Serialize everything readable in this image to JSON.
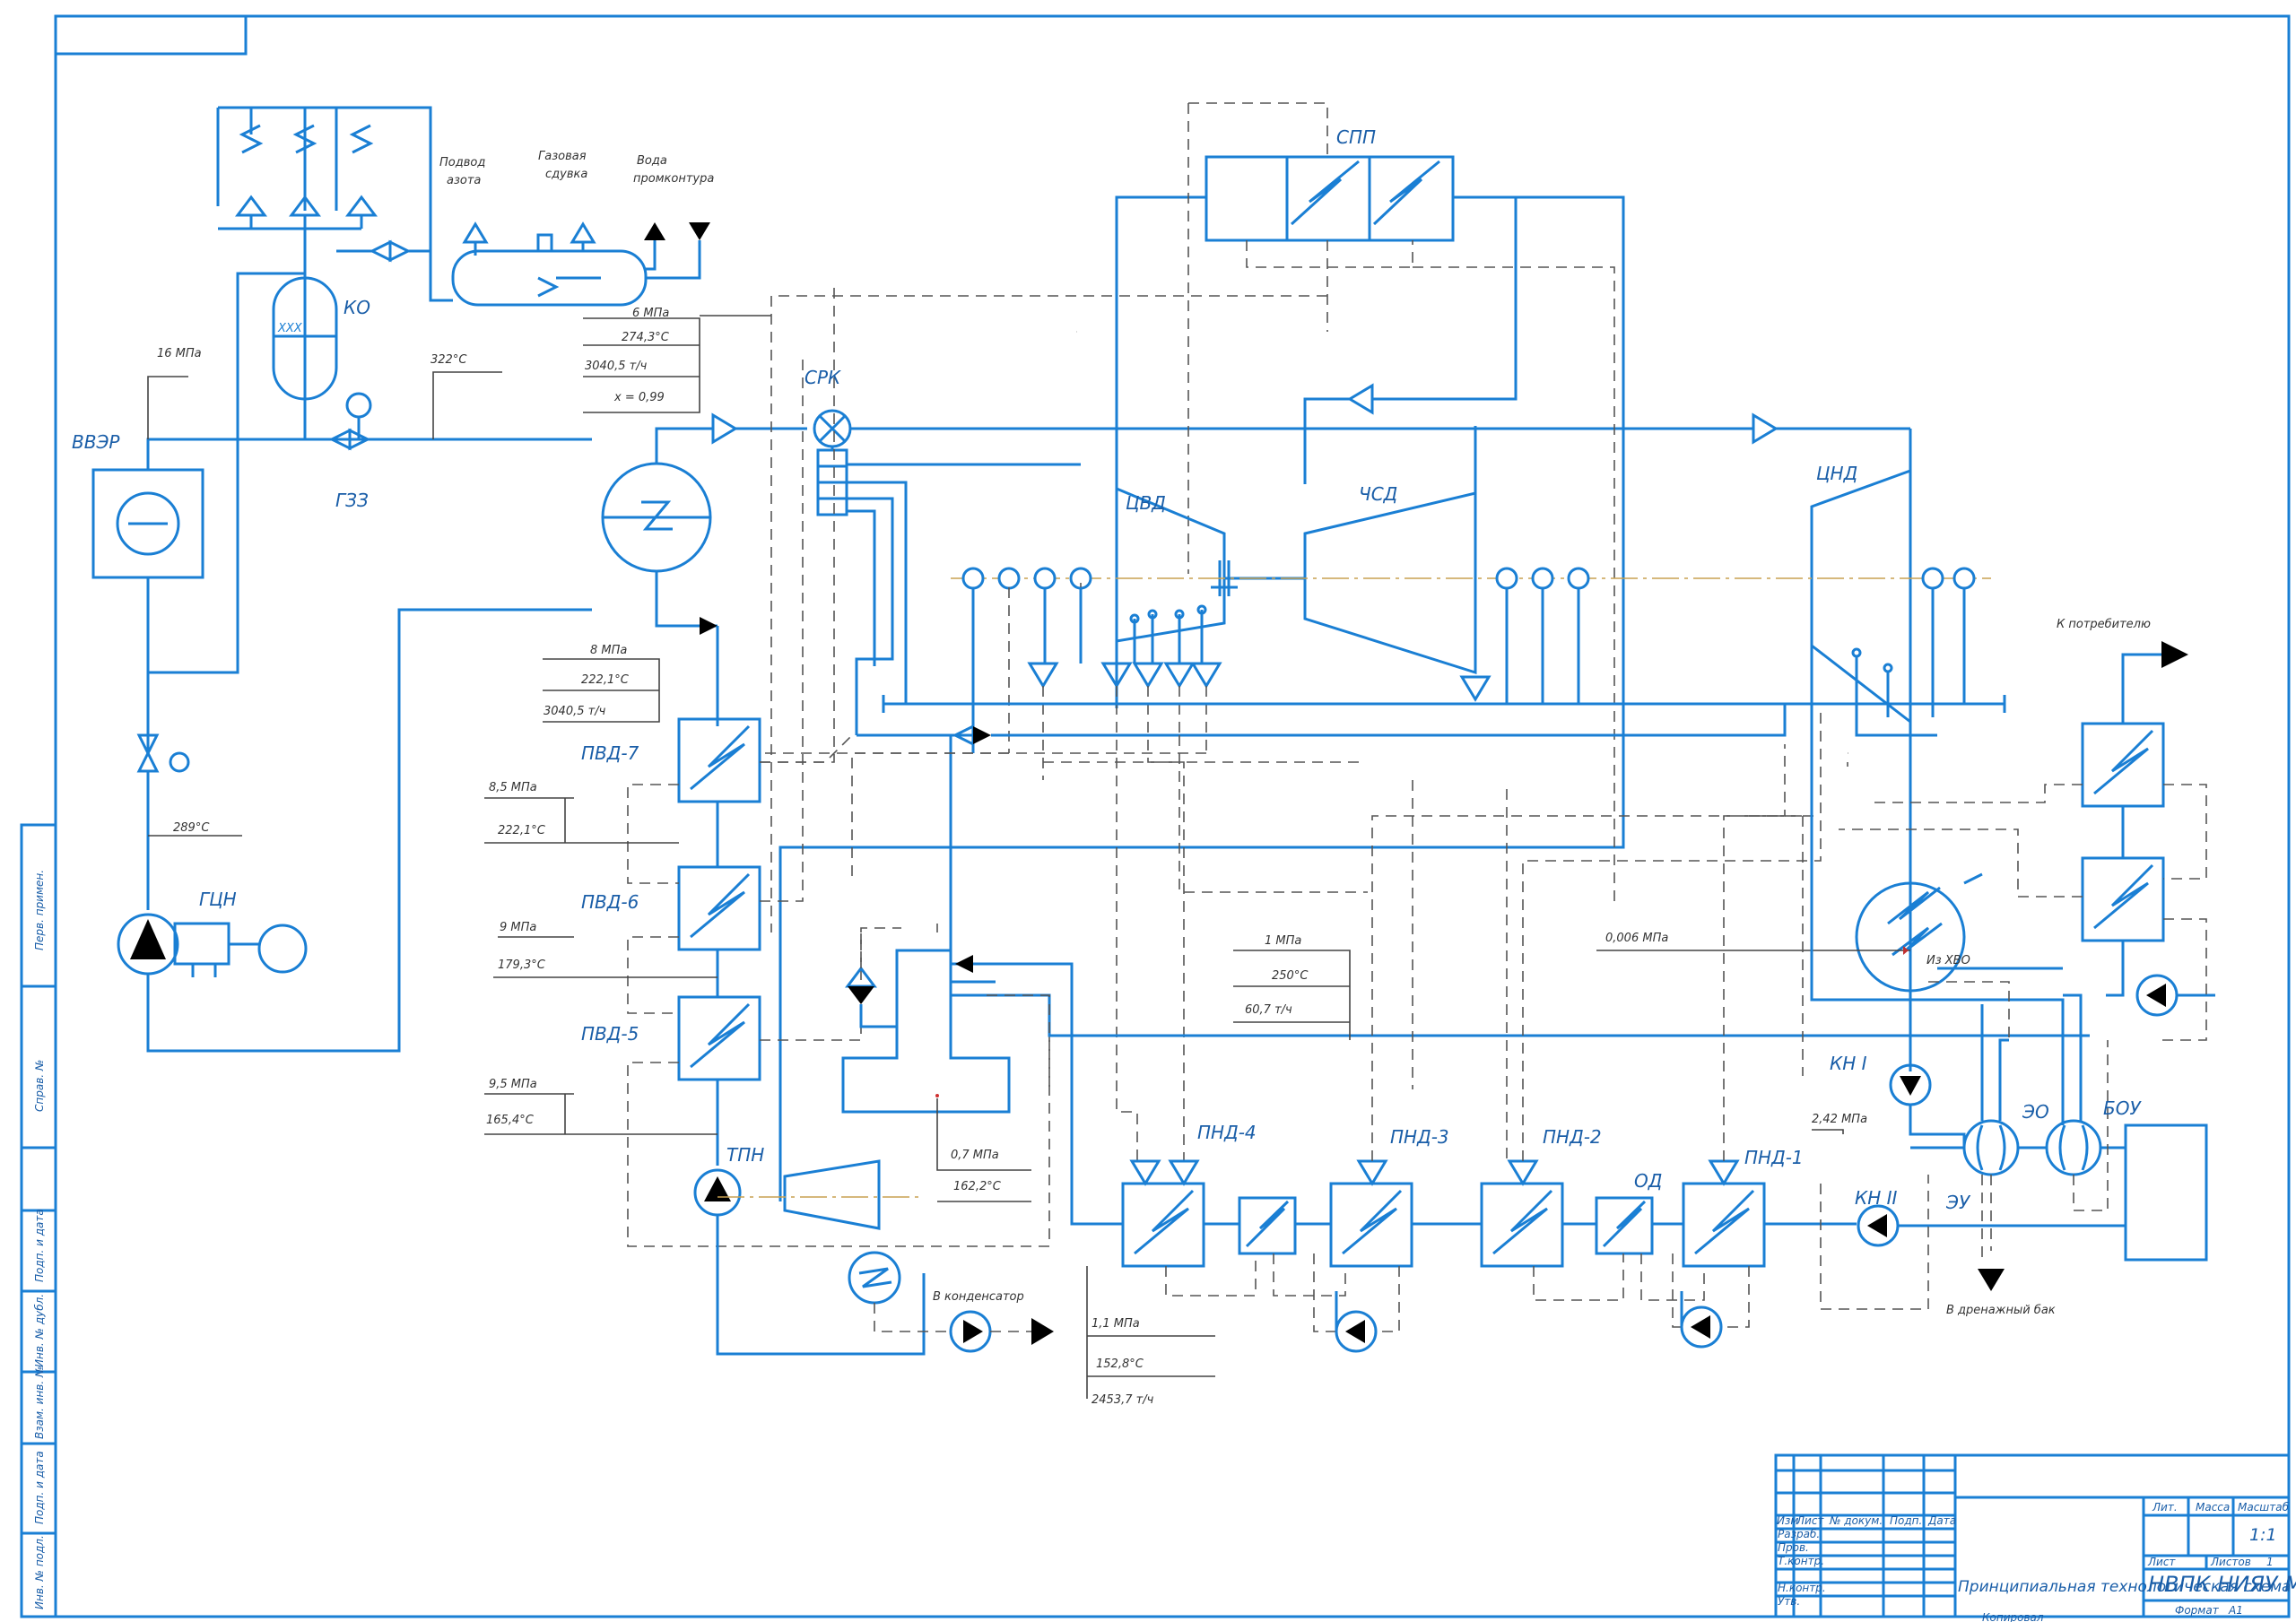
{
  "labels": {
    "vvzr": "ВВЭР",
    "ko": "КО",
    "gzz": "ГЗЗ",
    "gcn": "ГЦН",
    "srk": "СРК",
    "spp": "СПП",
    "cvd": "ЦВД",
    "csd": "ЧСД",
    "cnd": "ЦНД",
    "pvd7": "ПВД-7",
    "pvd6": "ПВД-6",
    "pvd5": "ПВД-5",
    "tpn": "ТПН",
    "pnd4": "ПНД-4",
    "pnd3": "ПНД-3",
    "pnd2": "ПНД-2",
    "pnd1": "ПНД-1",
    "od": "ОД",
    "kn1": "КН I",
    "kn2": "КН II",
    "eo": "ЭО",
    "eu": "ЭУ",
    "bou": "БОУ"
  },
  "notes": {
    "nitrogen": [
      "Подвод",
      "азота"
    ],
    "gas": [
      "Газовая",
      "сдувка"
    ],
    "water": [
      "Вода",
      "промконтура"
    ],
    "consumer": "К потребителю",
    "hvo": "Из ХВО",
    "to_condenser": "В конденсатор",
    "drain_tank": "В дренажный бак"
  },
  "params": {
    "p_16": "16 МПа",
    "t_322": "322°С",
    "t_289": "289°С",
    "main_steam": [
      "6 МПа",
      "274,3°С",
      "3040,5 т/ч",
      "x = 0,99"
    ],
    "fw_out": [
      "8 МПа",
      "222,1°С",
      "3040,5 т/ч"
    ],
    "pvd7": [
      "8,5 МПа",
      "222,1°С"
    ],
    "pvd6": [
      "9 МПа",
      "179,3°С"
    ],
    "pvd5": [
      "9,5 МПа",
      "165,4°С"
    ],
    "deaerator": [
      "1 МПа",
      "250°С",
      "60,7 т/ч"
    ],
    "tpn": [
      "0,7 МПа",
      "162,2°С"
    ],
    "condensate": [
      "1,1 МПа",
      "152,8°С",
      "2453,7 т/ч"
    ],
    "p_cond": "0,006 МПа",
    "p_kn": "2,42 МПа"
  },
  "stamp": {
    "headers": [
      "Изм",
      "Лист",
      "№ докум.",
      "Подп.",
      "Дата"
    ],
    "rows": [
      "Разраб.",
      "Пров.",
      "Т.контр.",
      "Н.контр.",
      "Утв."
    ],
    "title": "Принципиальная технологическая схема",
    "org": "НВПК НИЯУ МИФИ",
    "lit": "Лит.",
    "mass": "Масса",
    "scale_h": "Масштаб",
    "scale": "1:1",
    "sheet": "Лист",
    "sheets": "Листов",
    "sheets_n": "1",
    "copied": "Копировал",
    "format": "Формат",
    "format_v": "А1"
  },
  "side_stamp": [
    "Перв. примен.",
    "Справ. №",
    "Подп. и дата",
    "Инв. № дубл.",
    "Взам. инв. №",
    "Подп. и дата",
    "Инв. № подл."
  ]
}
